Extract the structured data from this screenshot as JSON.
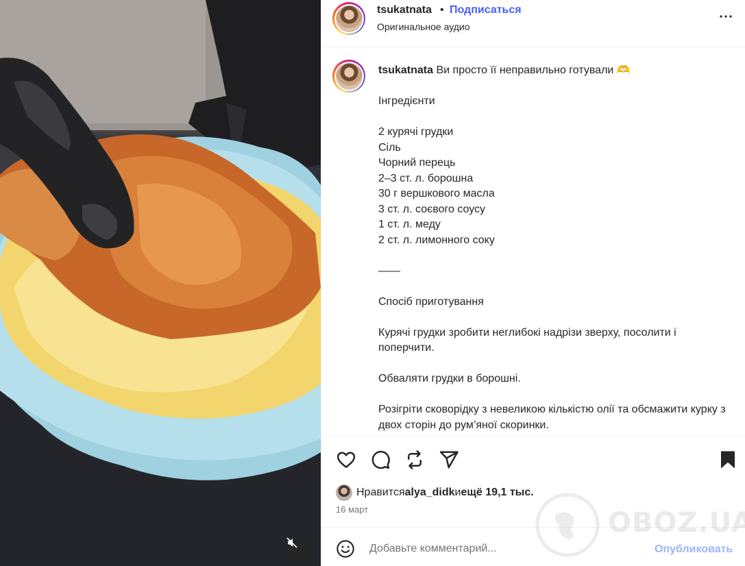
{
  "media": {
    "mute_icon": "speaker-muted-icon",
    "description_colors": {
      "plate": "#a9d8e6",
      "puree": "#f3dc78",
      "chicken": "#c96a2a",
      "glove": "#1c1c1e"
    }
  },
  "header": {
    "username": "tsukatnata",
    "separator": "•",
    "follow_label": "Подписаться",
    "audio_label": "Оригинальное аудио",
    "more_icon": "more-horizontal-icon"
  },
  "caption": {
    "username": "tsukatnata",
    "title": " Ви просто її неправильно готували 🫶",
    "lines": [
      "Інгредієнти",
      "",
      "2 курячі грудки",
      "Сіль",
      "Чорний перець",
      "2–3 ст. л. борошна",
      "30 г вершкового масла",
      "3 ст. л. соєвого соусу",
      "1 ст. л. меду",
      "2 ст. л. лимонного соку",
      "",
      "——",
      "",
      "Спосіб приготування",
      "",
      "Курячі грудки зробити неглибокі надрізи зверху, посолити і поперчити.",
      "",
      "Обваляти грудки в борошні.",
      "",
      "Розігріти сковорідку з невеликою кількістю олії та обсмажити курку з двох сторін до рум’яної скоринки."
    ]
  },
  "actions": {
    "like_icon": "heart-icon",
    "comment_icon": "comment-icon",
    "repost_icon": "repost-icon",
    "share_icon": "send-icon",
    "save_icon": "bookmark-icon",
    "likes_prefix": "Нравится ",
    "likes_user": "alya_didk",
    "likes_middle": " и ",
    "likes_rest": "ещё 19,1 тыс.",
    "date": "16 март"
  },
  "comment": {
    "emoji_icon": "emoji-icon",
    "placeholder": "Добавьте комментарий...",
    "publish_label": "Опубликовать"
  },
  "watermark": {
    "text": "OBOZ.UA",
    "logo_icon": "globe-logo-icon"
  }
}
